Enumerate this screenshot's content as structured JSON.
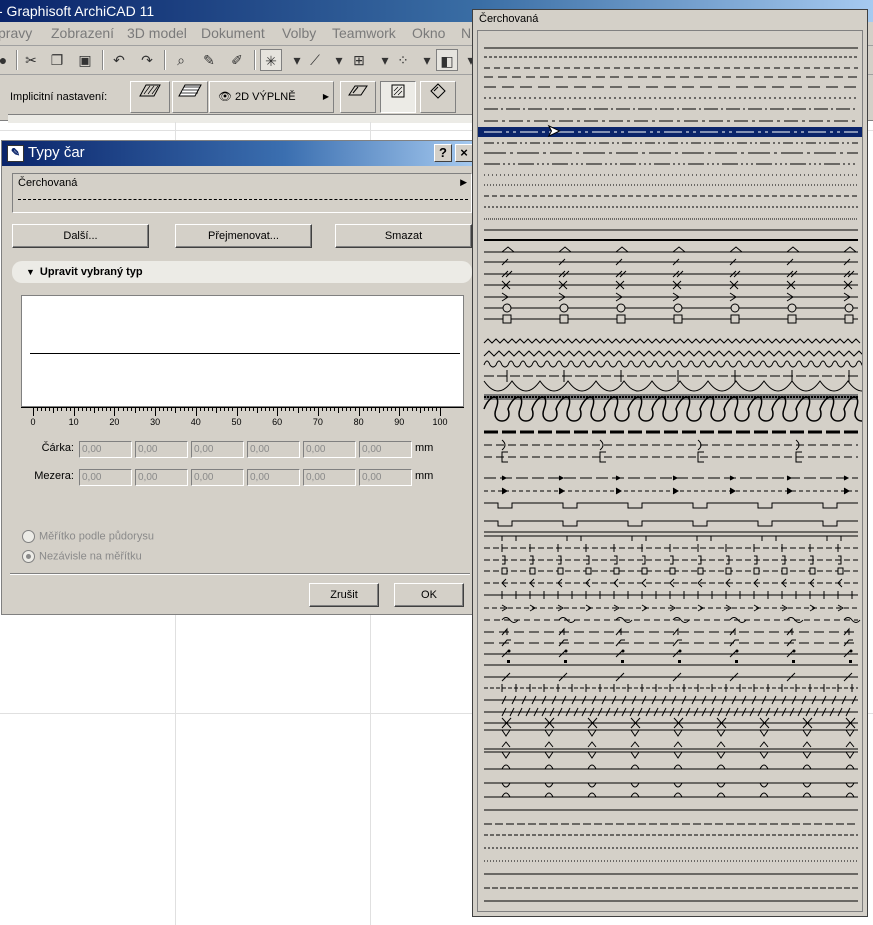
{
  "app": {
    "title": "- Graphisoft ArchiCAD 11"
  },
  "menu": {
    "items": [
      "pravy",
      "Zobrazení",
      "3D model",
      "Dokument",
      "Volby",
      "Teamwork",
      "Okno",
      "N"
    ]
  },
  "infobox": {
    "label": "Implicitní nastavení:",
    "fill_button": "2D VÝPLNĚ"
  },
  "dialog": {
    "title": "Typy čar",
    "help_label": "?",
    "close_label": "×",
    "selected_type": "Čerchovaná",
    "buttons": {
      "next": "Další...",
      "rename": "Přejmenovat...",
      "delete": "Smazat"
    },
    "section_header": "Upravit vybraný typ",
    "ruler_labels": [
      "0",
      "10",
      "20",
      "30",
      "40",
      "50",
      "60",
      "70",
      "80",
      "90",
      "100"
    ],
    "dash_label": "Čárka:",
    "gap_label": "Mezera:",
    "dash_values": [
      "0,00",
      "0,00",
      "0,00",
      "0,00",
      "0,00",
      "0,00"
    ],
    "gap_values": [
      "0,00",
      "0,00",
      "0,00",
      "0,00",
      "0,00",
      "0,00"
    ],
    "unit": "mm",
    "radio_scale_plan": "Měřítko podle půdorysu",
    "radio_scale_independent": "Nezávisle na měřítku",
    "cancel": "Zrušit",
    "ok": "OK"
  },
  "dropdown": {
    "title": "Čerchovaná",
    "selected_index": 8,
    "highlight_color": "#0a246a"
  },
  "colors": {
    "titlebar_start": "#0a246a",
    "face": "#d4d0c8"
  }
}
